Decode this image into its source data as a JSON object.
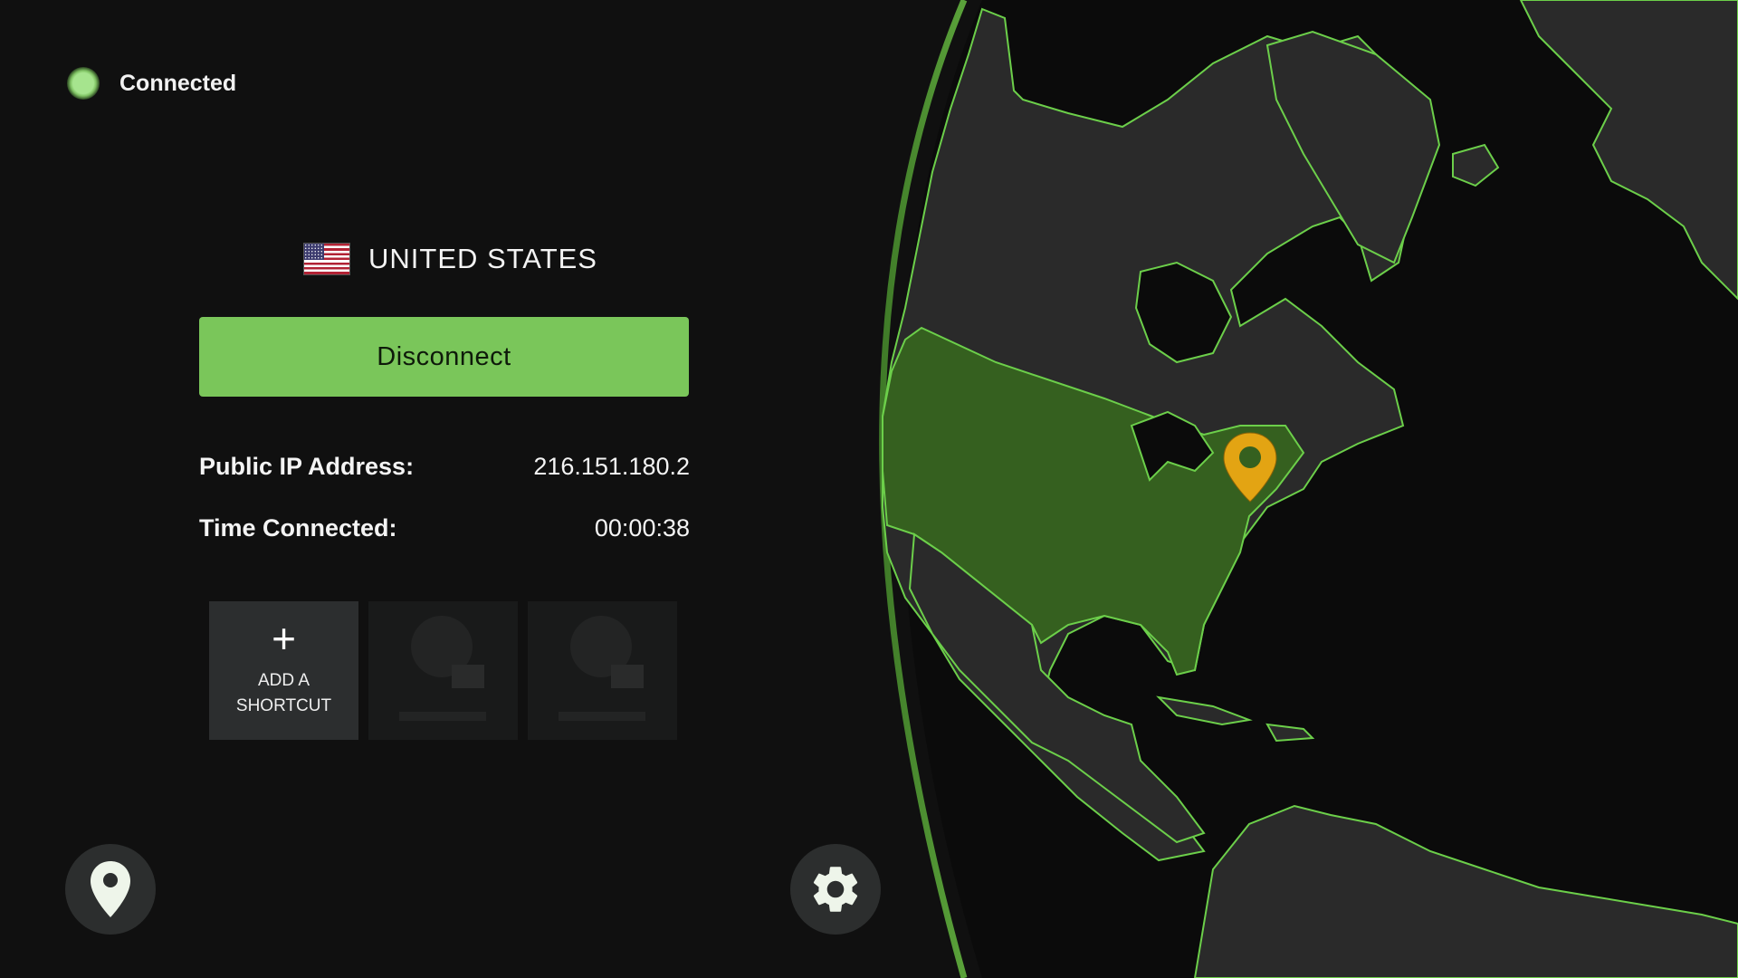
{
  "status": {
    "label": "Connected",
    "color": "#7fc263"
  },
  "location": {
    "country": "UNITED STATES",
    "flag_icon": "us-flag-icon"
  },
  "action": {
    "disconnect_label": "Disconnect",
    "color": "#7ac65a"
  },
  "info": [
    {
      "label": "Public IP Address:",
      "value": "216.151.180.2"
    },
    {
      "label": "Time Connected:",
      "value": "00:00:38"
    }
  ],
  "shortcuts": {
    "add_label_line1": "ADD A",
    "add_label_line2": "SHORTCUT",
    "add_icon": "plus-icon",
    "placeholders": 2
  },
  "bottom_bar": {
    "location_icon": "location-pin-icon",
    "settings_icon": "gear-icon"
  },
  "map": {
    "highlighted_country": "United States",
    "marker_color": "#e3a413",
    "land_color": "#2a2a2a",
    "highlight_color": "#35601f",
    "border_color": "#6ccf4a"
  }
}
